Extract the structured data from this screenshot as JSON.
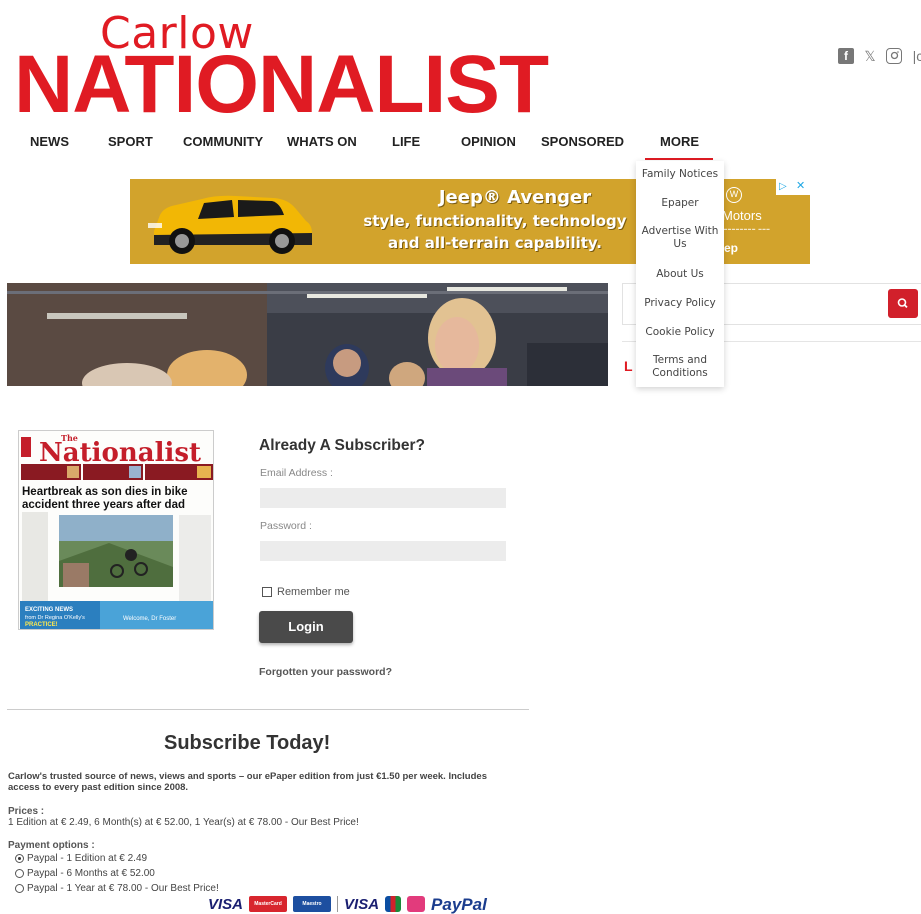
{
  "brand": {
    "line1": "Carlow",
    "line2": "NATIONALIST"
  },
  "social": [
    {
      "icon": "facebook-icon",
      "glyph": "f"
    },
    {
      "icon": "x-icon",
      "glyph": "𝕏"
    },
    {
      "icon": "instagram-icon",
      "glyph": "◎"
    }
  ],
  "nav": {
    "items": [
      "NEWS",
      "SPORT",
      "COMMUNITY",
      "WHATS ON",
      "LIFE",
      "OPINION",
      "SPONSORED",
      "MORE"
    ],
    "active": "MORE"
  },
  "more_menu": {
    "items": [
      "Family Notices",
      "Epaper",
      "Advertise With Us",
      "About Us",
      "Privacy Policy",
      "Cookie Policy",
      "Terms and Conditions"
    ]
  },
  "ad": {
    "title": "Jeep® Avenger",
    "line1": "style, functionality, technology",
    "line2": "and all-terrain capability.",
    "dealer": "Motors",
    "dealer_small": "ep",
    "accent": "#d2a32c"
  },
  "search": {
    "icon": "search-icon",
    "button_color": "#d1202b"
  },
  "login": {
    "title": "Already A Subscriber?",
    "email_label": "Email Address :",
    "password_label": "Password :",
    "remember_label": "Remember me",
    "button_label": "Login",
    "forgot_label": "Forgotten your password?"
  },
  "paper_cover": {
    "masthead": "The Nationalist",
    "headline": "Heartbreak as son dies in bike accident three years after dad",
    "promo": "Welcome, Dr Foster",
    "promo_left": "EXCITING NEWS from Dr Regina O'Kelly's PRACTICE"
  },
  "subscribe": {
    "title": "Subscribe Today!",
    "description": "Carlow's trusted source of news, views and sports – our ePaper edition from just €1.50 per week. Includes access to every past edition since 2008.",
    "prices_heading": "Prices :",
    "prices_text": "1 Edition at € 2.49, 6 Month(s) at € 52.00, 1 Year(s) at € 78.00 - Our Best Price!",
    "payment_heading": "Payment options :",
    "options": [
      {
        "label": "Paypal - 1 Edition at € 2.49",
        "selected": true
      },
      {
        "label": "Paypal - 6 Months at € 52.00",
        "selected": false
      },
      {
        "label": "Paypal - 1 Year at € 78.00 - Our Best Price!",
        "selected": false
      }
    ]
  },
  "payment_logos": {
    "visa": "VISA",
    "mastercard": "MasterCard",
    "maestro": "Maestro",
    "visa2": "VISA",
    "paypal": "PayPal"
  }
}
